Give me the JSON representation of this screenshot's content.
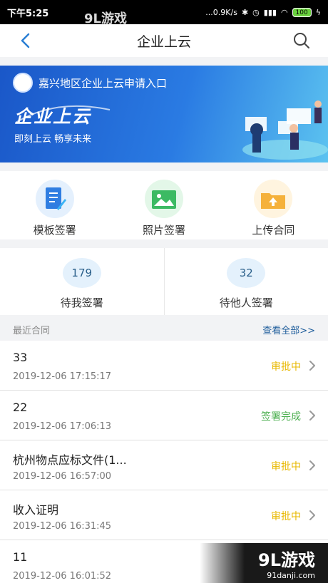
{
  "status_bar": {
    "time": "下午5:25",
    "net_speed": "...0.9K/s",
    "battery": "100"
  },
  "watermark": {
    "brand": "9L游戏",
    "site": "91danji.com"
  },
  "nav": {
    "title": "企业上云"
  },
  "banner": {
    "entry_text": "嘉兴地区企业上云申请入口",
    "headline": "企业上云",
    "slogan": "即刻上云 畅享未来"
  },
  "quick_actions": [
    {
      "label": "模板签署",
      "icon": "document-pen-icon"
    },
    {
      "label": "照片签署",
      "icon": "photo-icon"
    },
    {
      "label": "上传合同",
      "icon": "folder-upload-icon"
    }
  ],
  "stats": [
    {
      "count": "179",
      "label": "待我签署"
    },
    {
      "count": "32",
      "label": "待他人签署"
    }
  ],
  "recent": {
    "title": "最近合同",
    "view_all": "查看全部>>"
  },
  "contracts": [
    {
      "name": "33",
      "time": "2019-12-06 17:15:17",
      "status": "审批中",
      "status_color": "#e8b800"
    },
    {
      "name": "22",
      "time": "2019-12-06 17:06:13",
      "status": "签署完成",
      "status_color": "#4caf50"
    },
    {
      "name": "杭州物点应标文件(1...",
      "time": "2019-12-06 16:57:00",
      "status": "审批中",
      "status_color": "#e8b800"
    },
    {
      "name": "收入证明",
      "time": "2019-12-06 16:31:45",
      "status": "审批中",
      "status_color": "#e8b800"
    },
    {
      "name": "11",
      "time": "2019-12-06 16:01:52",
      "status": "",
      "status_color": "#e8b800"
    }
  ]
}
